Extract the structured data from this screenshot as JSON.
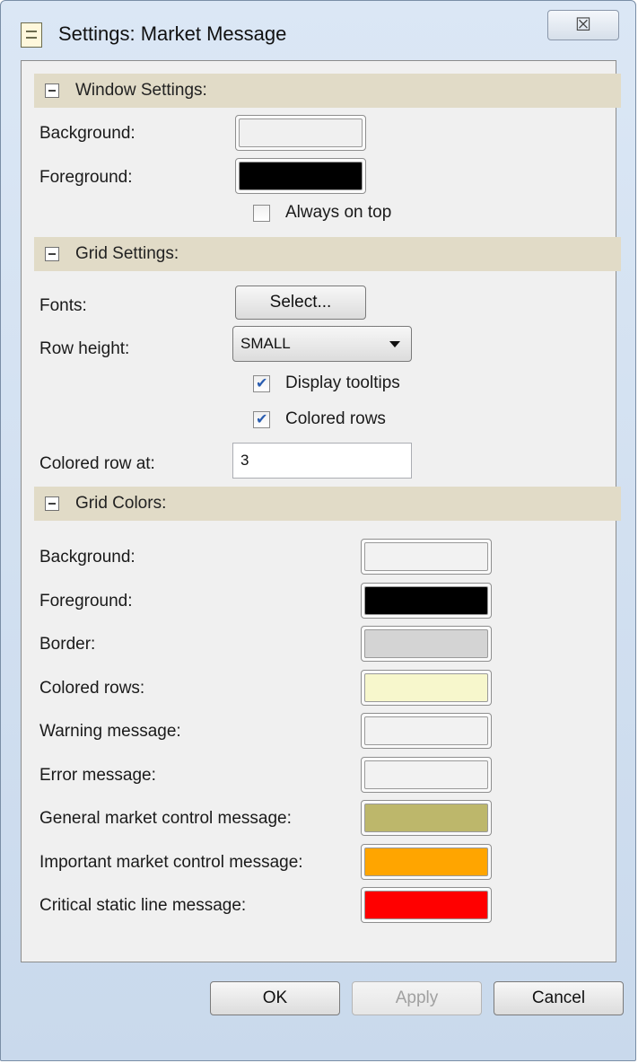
{
  "window": {
    "title": "Settings: Market Message",
    "close_glyph": "☒"
  },
  "sections": {
    "window_settings": {
      "title": "Window Settings:",
      "background_label": "Background:",
      "background_color": "#f0f0f0",
      "foreground_label": "Foreground:",
      "foreground_color": "#000000",
      "always_on_top_label": "Always on top",
      "always_on_top_checked": false
    },
    "grid_settings": {
      "title": "Grid Settings:",
      "fonts_label": "Fonts:",
      "fonts_button": "Select...",
      "row_height_label": "Row height:",
      "row_height_value": "SMALL",
      "display_tooltips_label": "Display tooltips",
      "display_tooltips_checked": true,
      "colored_rows_label": "Colored rows",
      "colored_rows_checked": true,
      "colored_row_at_label": "Colored row at:",
      "colored_row_at_value": "3"
    },
    "grid_colors": {
      "title": "Grid Colors:",
      "items": [
        {
          "label": "Background:",
          "color": "#f2f2f2"
        },
        {
          "label": "Foreground:",
          "color": "#000000"
        },
        {
          "label": "Border:",
          "color": "#d4d4d4"
        },
        {
          "label": "Colored rows:",
          "color": "#f7f7cc"
        },
        {
          "label": "Warning message:",
          "color": "#f2f2f2"
        },
        {
          "label": "Error message:",
          "color": "#f2f2f2"
        },
        {
          "label": "General market control message:",
          "color": "#bdb76b"
        },
        {
          "label": "Important market control message:",
          "color": "#ffa500"
        },
        {
          "label": "Critical static line message:",
          "color": "#ff0000"
        }
      ]
    }
  },
  "buttons": {
    "ok": "OK",
    "apply": "Apply",
    "cancel": "Cancel"
  }
}
